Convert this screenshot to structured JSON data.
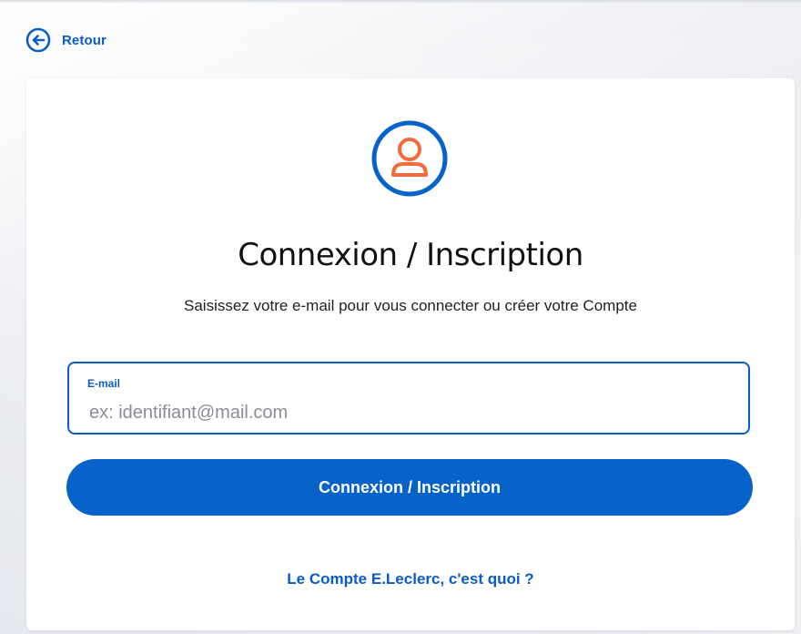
{
  "nav": {
    "back_label": "Retour",
    "back_icon": "arrow-left-circle-icon"
  },
  "login": {
    "avatar_icon": "user-avatar-icon",
    "title": "Connexion / Inscription",
    "subtitle": "Saisissez votre e-mail pour vous connecter ou créer votre Compte",
    "email_label": "E-mail",
    "email_placeholder": "ex: identifiant@mail.com",
    "email_value": "",
    "submit_label": "Connexion / Inscription",
    "info_link": "Le Compte E.Leclerc, c'est quoi ?"
  },
  "colors": {
    "primary": "#0763c9",
    "avatar_accent": "#f26b3a",
    "background": "#eef0f4"
  }
}
